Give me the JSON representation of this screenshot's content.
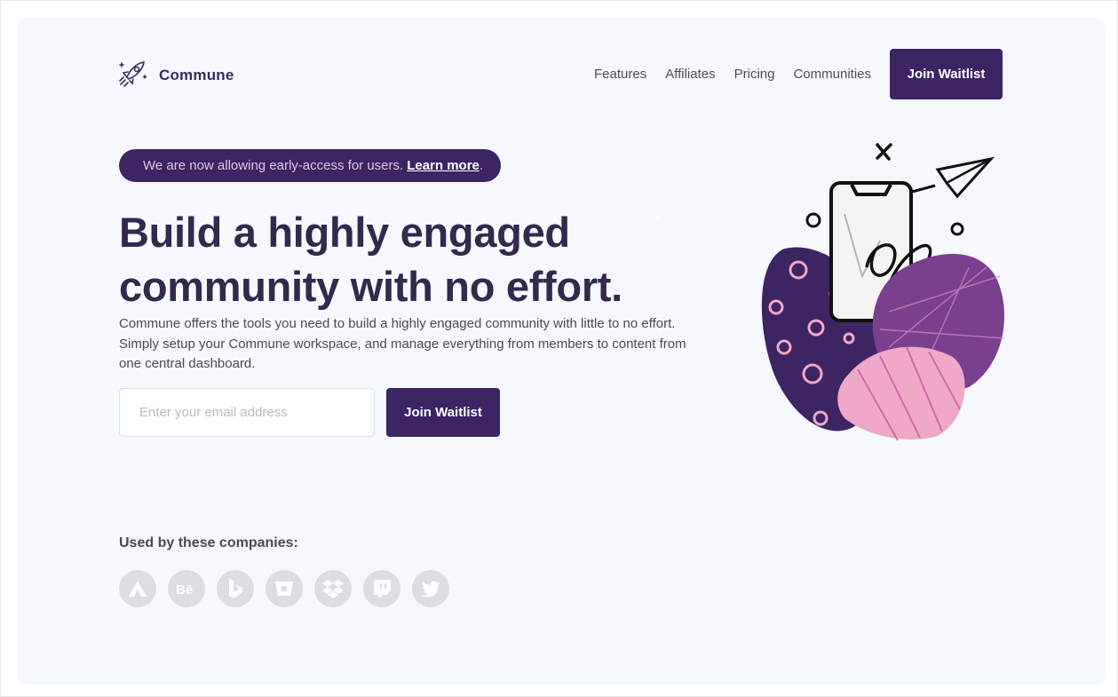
{
  "brand": {
    "name": "Commune",
    "icon": "rocket-icon"
  },
  "nav": {
    "links": [
      "Features",
      "Affiliates",
      "Pricing",
      "Communities"
    ],
    "cta": "Join Waitlist"
  },
  "banner": {
    "text": "We are now allowing early-access for users.",
    "link": "Learn more",
    "suffix": "."
  },
  "hero": {
    "headline_line1": "Build a highly engaged",
    "headline_line2": "community with no effort.",
    "subtext_line1": "Commune offers the tools you need to build a highly engaged community with little to no effort.",
    "subtext_line2": "Simply setup your Commune workspace, and manage everything from members to content from",
    "subtext_line3": "one central dashboard.",
    "email_placeholder": "Enter your email address",
    "cta": "Join Waitlist"
  },
  "companies": {
    "label": "Used by these companies:",
    "logos": [
      "airtable-icon",
      "behance-icon",
      "bing-icon",
      "bitbucket-icon",
      "dropbox-icon",
      "twitch-icon",
      "twitter-icon"
    ]
  },
  "colors": {
    "primary": "#3c2465",
    "background": "#f5f8fd",
    "heading": "#33294d",
    "pink": "#f0a8c8",
    "purple": "#7b3f8f",
    "dark_purple": "#3d2463"
  }
}
